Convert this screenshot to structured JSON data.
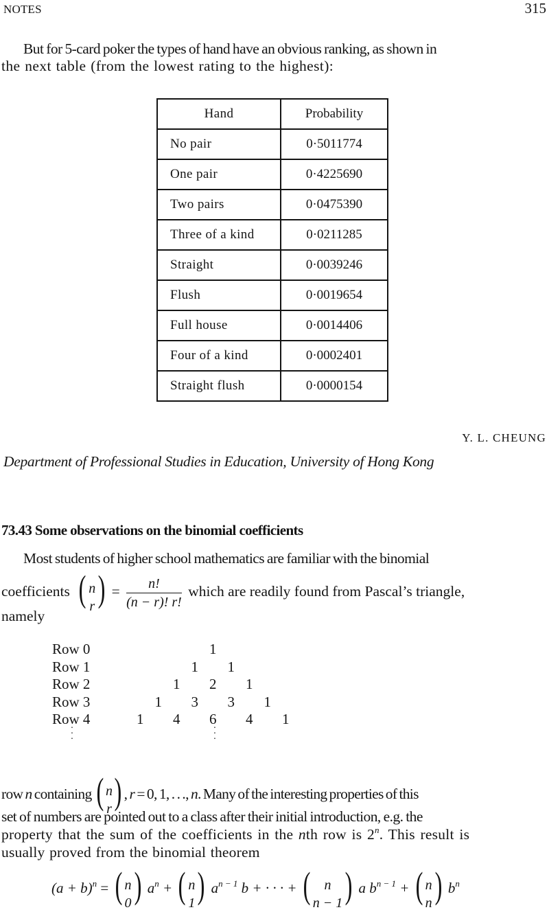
{
  "header": {
    "running_head": "NOTES",
    "page_number": "315"
  },
  "intro_paragraph": {
    "line1": "But for 5-card poker the types of hand have an obvious ranking, as shown in",
    "line2": "the next table (from the lowest rating to the highest):"
  },
  "poker_table": {
    "headers": [
      "Hand",
      "Probability"
    ],
    "rows": [
      {
        "hand": "No pair",
        "probability": "0·5011774"
      },
      {
        "hand": "One pair",
        "probability": "0·4225690"
      },
      {
        "hand": "Two pairs",
        "probability": "0·0475390"
      },
      {
        "hand": "Three of a kind",
        "probability": "0·0211285"
      },
      {
        "hand": "Straight",
        "probability": "0·0039246"
      },
      {
        "hand": "Flush",
        "probability": "0·0019654"
      },
      {
        "hand": "Full house",
        "probability": "0·0014406"
      },
      {
        "hand": "Four of a kind",
        "probability": "0·0002401"
      },
      {
        "hand": "Straight flush",
        "probability": "0·0000154"
      }
    ]
  },
  "signature": {
    "author": "Y. L. CHEUNG",
    "affiliation": "Department of Professional Studies in Education, University of Hong Kong"
  },
  "section": {
    "title": "73.43 Some observations on the binomial coefficients",
    "line1": "Most students of higher school mathematics are familiar with the binomial",
    "coef_prefix": "coefficients",
    "binom_top": "n",
    "binom_bottom": "r",
    "equals": "=",
    "frac_num": "n!",
    "frac_den": "(n − r)! r!",
    "coef_suffix": "which are readily found from Pascal’s triangle,",
    "namely": "namely"
  },
  "pascal_triangle": {
    "rows": [
      {
        "label": "Row 0",
        "values": [
          "1"
        ]
      },
      {
        "label": "Row 1",
        "values": [
          "1",
          "1"
        ]
      },
      {
        "label": "Row 2",
        "values": [
          "1",
          "2",
          "1"
        ]
      },
      {
        "label": "Row 3",
        "values": [
          "1",
          "3",
          "3",
          "1"
        ]
      },
      {
        "label": "Row 4",
        "values": [
          "1",
          "4",
          "6",
          "4",
          "1"
        ]
      }
    ],
    "continuation": "⋮"
  },
  "paragraph3": {
    "prefix": "row ",
    "n_var": "n",
    "containing": " containing",
    "binom_top": "n",
    "binom_bottom": "r",
    "after_binom_1": ", ",
    "r_var": "r",
    "after_binom_2": " = 0, 1, . . ., ",
    "n_var2": "n",
    "after_binom_3": ". Many of the interesting properties of this",
    "line2": "set of numbers are pointed out to a class after their initial introduction, e.g. the",
    "line3_a": "property that the sum of the coefficients in the ",
    "line3_n": "n",
    "line3_b": "th row is  2",
    "line3_sup": "n",
    "line3_c": ". This result is",
    "line4": "usually proved from the binomial theorem"
  },
  "equation": {
    "lhs": "(a + b)",
    "lhs_sup": "n",
    "equals": " = ",
    "terms": [
      {
        "top": "n",
        "bottom": "0",
        "after": " a",
        "after_sup": "n",
        "tail": " + "
      },
      {
        "top": "n",
        "bottom": "1",
        "after": " a",
        "after_sup": "n − 1",
        "tail": " b + · · · + "
      },
      {
        "top": "n",
        "bottom": "n − 1",
        "after": " a b",
        "after_sup": "n − 1",
        "tail": " + "
      },
      {
        "top": "n",
        "bottom": "n",
        "after": " b",
        "after_sup": "n",
        "tail": ""
      }
    ]
  }
}
